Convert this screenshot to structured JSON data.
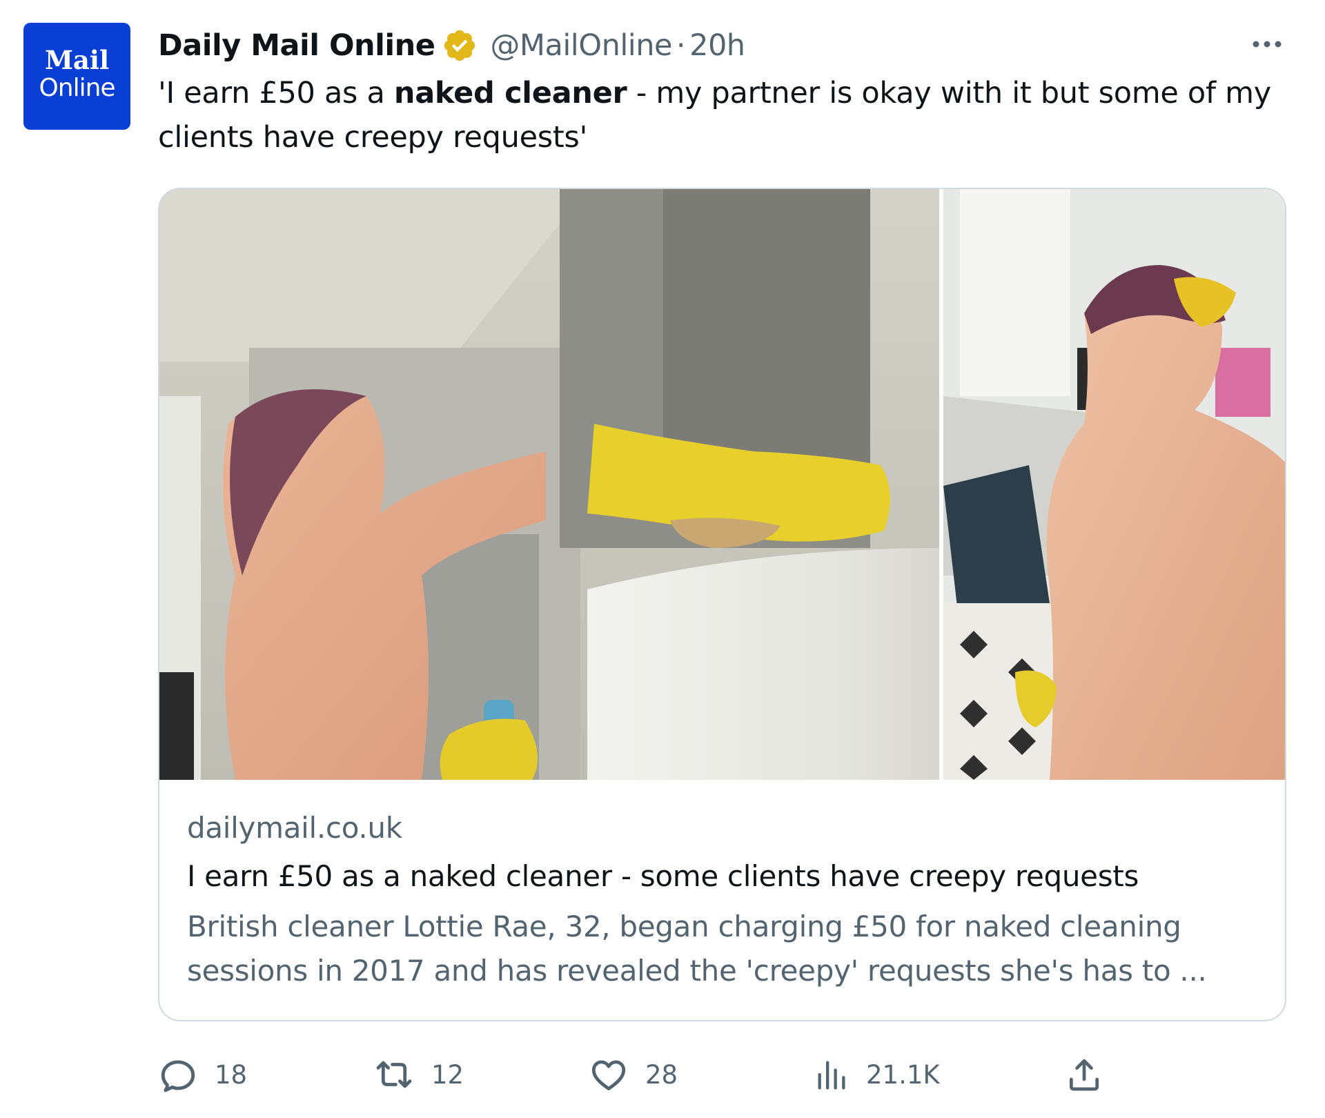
{
  "author": {
    "name": "Daily Mail Online",
    "handle": "@MailOnline",
    "separator": "·",
    "time": "20h",
    "avatar_top": "Mail",
    "avatar_bottom": "Online",
    "verified_icon": "verified-badge-gold"
  },
  "tweet": {
    "text_before": "'I earn £50 as a ",
    "text_bold": "naked cleaner",
    "text_after": " - my partner is okay with it but some of my clients have creepy requests'"
  },
  "card": {
    "domain": "dailymail.co.uk",
    "title": "I earn £50 as a naked cleaner - some clients have creepy requests",
    "description": "British cleaner Lottie Rae, 32, began charging £50 for naked cleaning sessions in 2017 and has revealed the 'creepy' requests she's has to ..."
  },
  "actions": {
    "replies": "18",
    "retweets": "12",
    "likes": "28",
    "views": "21.1K"
  },
  "colors": {
    "text_primary": "#0f1419",
    "text_secondary": "#536471",
    "avatar_bg": "#0a3fd6",
    "verified_gold": "#e2b719",
    "card_border": "#cfd9de"
  }
}
